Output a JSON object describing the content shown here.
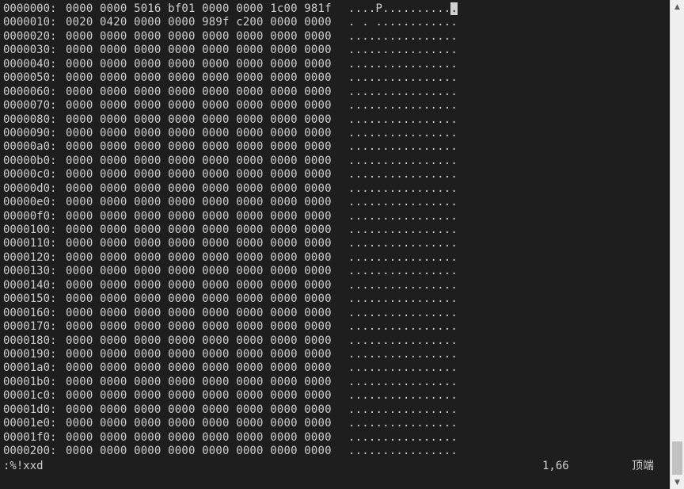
{
  "rows": [
    {
      "addr": "0000000:",
      "hex": "0000 0000 5016 bf01 0000 0000 1c00 981f",
      "ascii": "....P..........",
      "cursor": "."
    },
    {
      "addr": "0000010:",
      "hex": "0020 0420 0000 0000 989f c200 0000 0000",
      "ascii": ". . ............"
    },
    {
      "addr": "0000020:",
      "hex": "0000 0000 0000 0000 0000 0000 0000 0000",
      "ascii": "................"
    },
    {
      "addr": "0000030:",
      "hex": "0000 0000 0000 0000 0000 0000 0000 0000",
      "ascii": "................"
    },
    {
      "addr": "0000040:",
      "hex": "0000 0000 0000 0000 0000 0000 0000 0000",
      "ascii": "................"
    },
    {
      "addr": "0000050:",
      "hex": "0000 0000 0000 0000 0000 0000 0000 0000",
      "ascii": "................"
    },
    {
      "addr": "0000060:",
      "hex": "0000 0000 0000 0000 0000 0000 0000 0000",
      "ascii": "................"
    },
    {
      "addr": "0000070:",
      "hex": "0000 0000 0000 0000 0000 0000 0000 0000",
      "ascii": "................"
    },
    {
      "addr": "0000080:",
      "hex": "0000 0000 0000 0000 0000 0000 0000 0000",
      "ascii": "................"
    },
    {
      "addr": "0000090:",
      "hex": "0000 0000 0000 0000 0000 0000 0000 0000",
      "ascii": "................"
    },
    {
      "addr": "00000a0:",
      "hex": "0000 0000 0000 0000 0000 0000 0000 0000",
      "ascii": "................"
    },
    {
      "addr": "00000b0:",
      "hex": "0000 0000 0000 0000 0000 0000 0000 0000",
      "ascii": "................"
    },
    {
      "addr": "00000c0:",
      "hex": "0000 0000 0000 0000 0000 0000 0000 0000",
      "ascii": "................"
    },
    {
      "addr": "00000d0:",
      "hex": "0000 0000 0000 0000 0000 0000 0000 0000",
      "ascii": "................"
    },
    {
      "addr": "00000e0:",
      "hex": "0000 0000 0000 0000 0000 0000 0000 0000",
      "ascii": "................"
    },
    {
      "addr": "00000f0:",
      "hex": "0000 0000 0000 0000 0000 0000 0000 0000",
      "ascii": "................"
    },
    {
      "addr": "0000100:",
      "hex": "0000 0000 0000 0000 0000 0000 0000 0000",
      "ascii": "................"
    },
    {
      "addr": "0000110:",
      "hex": "0000 0000 0000 0000 0000 0000 0000 0000",
      "ascii": "................"
    },
    {
      "addr": "0000120:",
      "hex": "0000 0000 0000 0000 0000 0000 0000 0000",
      "ascii": "................"
    },
    {
      "addr": "0000130:",
      "hex": "0000 0000 0000 0000 0000 0000 0000 0000",
      "ascii": "................"
    },
    {
      "addr": "0000140:",
      "hex": "0000 0000 0000 0000 0000 0000 0000 0000",
      "ascii": "................"
    },
    {
      "addr": "0000150:",
      "hex": "0000 0000 0000 0000 0000 0000 0000 0000",
      "ascii": "................"
    },
    {
      "addr": "0000160:",
      "hex": "0000 0000 0000 0000 0000 0000 0000 0000",
      "ascii": "................"
    },
    {
      "addr": "0000170:",
      "hex": "0000 0000 0000 0000 0000 0000 0000 0000",
      "ascii": "................"
    },
    {
      "addr": "0000180:",
      "hex": "0000 0000 0000 0000 0000 0000 0000 0000",
      "ascii": "................"
    },
    {
      "addr": "0000190:",
      "hex": "0000 0000 0000 0000 0000 0000 0000 0000",
      "ascii": "................"
    },
    {
      "addr": "00001a0:",
      "hex": "0000 0000 0000 0000 0000 0000 0000 0000",
      "ascii": "................"
    },
    {
      "addr": "00001b0:",
      "hex": "0000 0000 0000 0000 0000 0000 0000 0000",
      "ascii": "................"
    },
    {
      "addr": "00001c0:",
      "hex": "0000 0000 0000 0000 0000 0000 0000 0000",
      "ascii": "................"
    },
    {
      "addr": "00001d0:",
      "hex": "0000 0000 0000 0000 0000 0000 0000 0000",
      "ascii": "................"
    },
    {
      "addr": "00001e0:",
      "hex": "0000 0000 0000 0000 0000 0000 0000 0000",
      "ascii": "................"
    },
    {
      "addr": "00001f0:",
      "hex": "0000 0000 0000 0000 0000 0000 0000 0000",
      "ascii": "................"
    },
    {
      "addr": "0000200:",
      "hex": "0000 0000 0000 0000 0000 0000 0000 0000",
      "ascii": "................"
    }
  ],
  "status": {
    "command": ":%!xxd",
    "position": "1,66",
    "scroll": "顶端"
  },
  "colors": {
    "background": "#1e1e1e",
    "text": "#d0d0d0",
    "cursor": "#d0d0d0"
  }
}
